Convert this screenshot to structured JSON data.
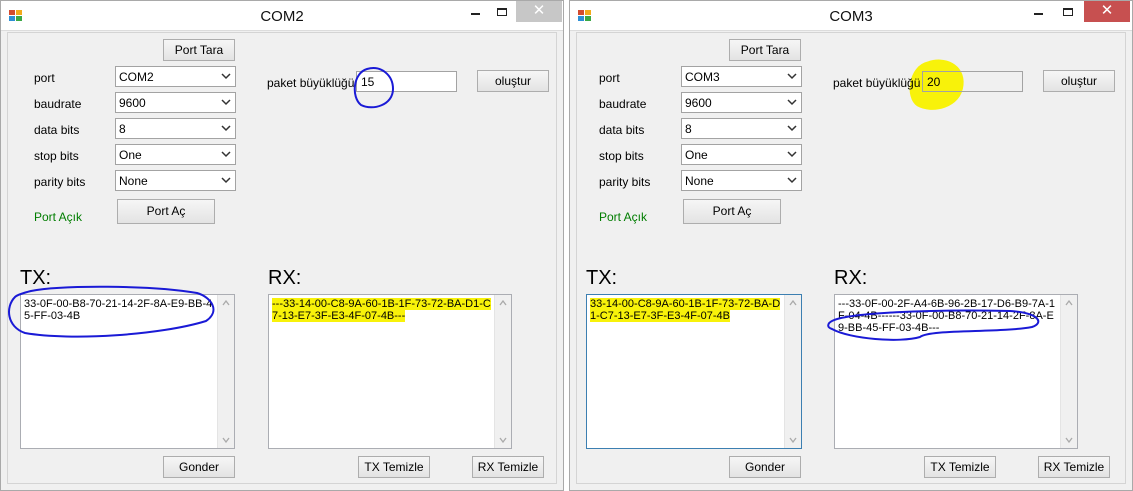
{
  "windows": [
    {
      "title": "COM2",
      "buttons": {
        "scan": "Port Tara",
        "open": "Port Aç",
        "create": "oluştur",
        "send": "Gonder",
        "tx_clear": "TX Temizle",
        "rx_clear": "RX Temizle"
      },
      "labels": {
        "port": "port",
        "baudrate": "baudrate",
        "data_bits": "data bits",
        "stop_bits": "stop bits",
        "parity_bits": "parity bits",
        "packet_size": "paket büyüklüğü",
        "status": "Port Açık",
        "tx": "TX:",
        "rx": "RX:"
      },
      "fields": {
        "port": "COM2",
        "baudrate": "9600",
        "data_bits": "8",
        "stop_bits": "One",
        "parity_bits": "None",
        "packet_size": "15"
      },
      "tx_text": "33-0F-00-B8-70-21-14-2F-8A-E9-BB-45-FF-03-4B",
      "rx_text": "---33-14-00-C8-9A-60-1B-1F-73-72-BA-D1-C7-13-E7-3F-E3-4F-07-4B---"
    },
    {
      "title": "COM3",
      "buttons": {
        "scan": "Port Tara",
        "open": "Port Aç",
        "create": "oluştur",
        "send": "Gonder",
        "tx_clear": "TX Temizle",
        "rx_clear": "RX Temizle"
      },
      "labels": {
        "port": "port",
        "baudrate": "baudrate",
        "data_bits": "data bits",
        "stop_bits": "stop bits",
        "parity_bits": "parity bits",
        "packet_size": "paket büyüklüğü",
        "status": "Port Açık",
        "tx": "TX:",
        "rx": "RX:"
      },
      "fields": {
        "port": "COM3",
        "baudrate": "9600",
        "data_bits": "8",
        "stop_bits": "One",
        "parity_bits": "None",
        "packet_size": "20"
      },
      "tx_text": "33-14-00-C8-9A-60-1B-1F-73-72-BA-D1-C7-13-E7-3F-E3-4F-07-4B",
      "rx_text_part1": "---33-0F-00-2F-A4-6B-96-2B-17-D6-B9-7A-1F-04-4B---",
      "rx_text_part2": "---33-0F-00-B8-70-21-14-2F-8A-E9-BB-45-FF-03-4B---"
    }
  ],
  "colors": {
    "status_green": "#007d00",
    "highlight_yellow": "#f8f20a",
    "annotation_blue": "#1a1ad6"
  },
  "icons": [
    "app-icon",
    "minimize-icon",
    "maximize-icon",
    "close-icon",
    "chevron-down-icon",
    "scroll-up-icon",
    "scroll-down-icon"
  ]
}
